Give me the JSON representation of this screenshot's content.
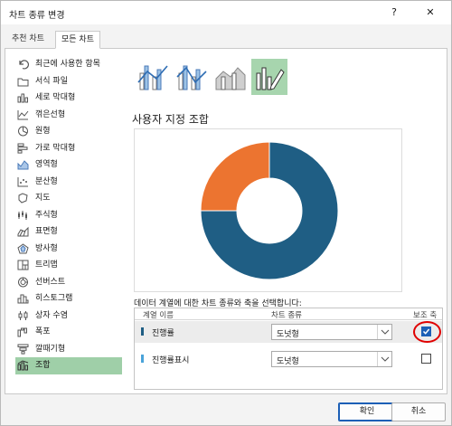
{
  "window": {
    "title": "차트 종류 변경",
    "help_glyph": "?",
    "close_glyph": "✕"
  },
  "tabs": [
    {
      "label": "추천 차트",
      "active": false
    },
    {
      "label": "모든 차트",
      "active": true
    }
  ],
  "sidebar": {
    "items": [
      {
        "label": "최근에 사용한 항목",
        "icon": "undo-icon"
      },
      {
        "label": "서식 파일",
        "icon": "folder-icon"
      },
      {
        "label": "세로 막대형",
        "icon": "column-chart-icon"
      },
      {
        "label": "꺾은선형",
        "icon": "line-chart-icon"
      },
      {
        "label": "원형",
        "icon": "pie-chart-icon"
      },
      {
        "label": "가로 막대형",
        "icon": "bar-chart-icon"
      },
      {
        "label": "영역형",
        "icon": "area-chart-icon"
      },
      {
        "label": "분산형",
        "icon": "scatter-chart-icon"
      },
      {
        "label": "지도",
        "icon": "map-chart-icon"
      },
      {
        "label": "주식형",
        "icon": "stock-chart-icon"
      },
      {
        "label": "표면형",
        "icon": "surface-chart-icon"
      },
      {
        "label": "방사형",
        "icon": "radar-chart-icon"
      },
      {
        "label": "트리맵",
        "icon": "treemap-icon"
      },
      {
        "label": "선버스트",
        "icon": "sunburst-icon"
      },
      {
        "label": "히스토그램",
        "icon": "histogram-icon"
      },
      {
        "label": "상자 수염",
        "icon": "box-whisker-icon"
      },
      {
        "label": "폭포",
        "icon": "waterfall-icon"
      },
      {
        "label": "깔때기형",
        "icon": "funnel-icon"
      },
      {
        "label": "조합",
        "icon": "combo-chart-icon",
        "selected": true
      }
    ]
  },
  "main": {
    "subtype_icons": [
      "clustered-column-line-icon",
      "clustered-column-line-secondary-axis-icon",
      "stacked-area-column-icon",
      "custom-combo-icon"
    ],
    "heading": "사용자 지정 조합",
    "series_instruction": "데이터 계열에 대한 차트 종류와 축을 선택합니다:",
    "grid": {
      "headers": [
        "계열 이름",
        "차트 종류",
        "보조 축"
      ],
      "rows": [
        {
          "name": "진행률",
          "chart_type": "도넛형",
          "secondary_axis": true,
          "color": "#1f5e84"
        },
        {
          "name": "진행률표시",
          "chart_type": "도넛형",
          "secondary_axis": false,
          "color": "#4aa3d9"
        }
      ]
    }
  },
  "chart_data": {
    "type": "pie",
    "subtype": "doughnut",
    "slices": [
      {
        "value": 75,
        "color": "#1f5e84"
      },
      {
        "value": 25,
        "color": "#ec7430"
      }
    ]
  },
  "buttons": {
    "ok": "확인",
    "cancel": "취소"
  }
}
